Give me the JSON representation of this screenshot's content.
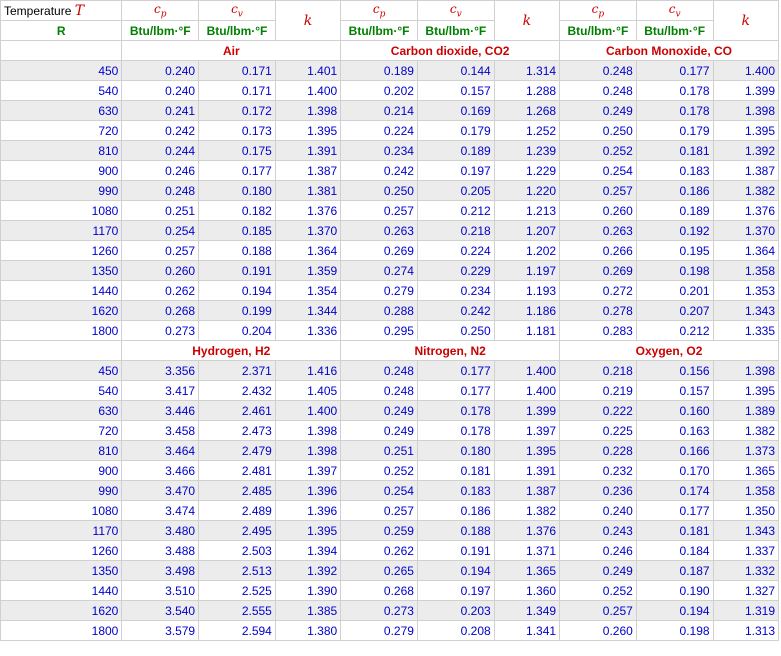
{
  "header": {
    "temperature_label": "Temperature",
    "temperature_symbol": "T",
    "temperature_unit": "R",
    "cp_symbol": "c",
    "cp_sub": "p",
    "cv_symbol": "c",
    "cv_sub": "v",
    "k_symbol": "k",
    "unit": "Btu/lbm·°F"
  },
  "colors": {
    "symbol": "#cc0000",
    "unit": "#008000",
    "value": "#0000cc",
    "stripe": "#ececec"
  },
  "temperatures": [
    "450",
    "540",
    "630",
    "720",
    "810",
    "900",
    "990",
    "1080",
    "1170",
    "1260",
    "1350",
    "1440",
    "1620",
    "1800"
  ],
  "groups": [
    {
      "gases": [
        "Air",
        "Carbon dioxide, CO2",
        "Carbon Monoxide, CO"
      ],
      "rows": [
        [
          "0.240",
          "0.171",
          "1.401",
          "0.189",
          "0.144",
          "1.314",
          "0.248",
          "0.177",
          "1.400"
        ],
        [
          "0.240",
          "0.171",
          "1.400",
          "0.202",
          "0.157",
          "1.288",
          "0.248",
          "0.178",
          "1.399"
        ],
        [
          "0.241",
          "0.172",
          "1.398",
          "0.214",
          "0.169",
          "1.268",
          "0.249",
          "0.178",
          "1.398"
        ],
        [
          "0.242",
          "0.173",
          "1.395",
          "0.224",
          "0.179",
          "1.252",
          "0.250",
          "0.179",
          "1.395"
        ],
        [
          "0.244",
          "0.175",
          "1.391",
          "0.234",
          "0.189",
          "1.239",
          "0.252",
          "0.181",
          "1.392"
        ],
        [
          "0.246",
          "0.177",
          "1.387",
          "0.242",
          "0.197",
          "1.229",
          "0.254",
          "0.183",
          "1.387"
        ],
        [
          "0.248",
          "0.180",
          "1.381",
          "0.250",
          "0.205",
          "1.220",
          "0.257",
          "0.186",
          "1.382"
        ],
        [
          "0.251",
          "0.182",
          "1.376",
          "0.257",
          "0.212",
          "1.213",
          "0.260",
          "0.189",
          "1.376"
        ],
        [
          "0.254",
          "0.185",
          "1.370",
          "0.263",
          "0.218",
          "1.207",
          "0.263",
          "0.192",
          "1.370"
        ],
        [
          "0.257",
          "0.188",
          "1.364",
          "0.269",
          "0.224",
          "1.202",
          "0.266",
          "0.195",
          "1.364"
        ],
        [
          "0.260",
          "0.191",
          "1.359",
          "0.274",
          "0.229",
          "1.197",
          "0.269",
          "0.198",
          "1.358"
        ],
        [
          "0.262",
          "0.194",
          "1.354",
          "0.279",
          "0.234",
          "1.193",
          "0.272",
          "0.201",
          "1.353"
        ],
        [
          "0.268",
          "0.199",
          "1.344",
          "0.288",
          "0.242",
          "1.186",
          "0.278",
          "0.207",
          "1.343"
        ],
        [
          "0.273",
          "0.204",
          "1.336",
          "0.295",
          "0.250",
          "1.181",
          "0.283",
          "0.212",
          "1.335"
        ]
      ]
    },
    {
      "gases": [
        "Hydrogen, H2",
        "Nitrogen, N2",
        "Oxygen, O2"
      ],
      "rows": [
        [
          "3.356",
          "2.371",
          "1.416",
          "0.248",
          "0.177",
          "1.400",
          "0.218",
          "0.156",
          "1.398"
        ],
        [
          "3.417",
          "2.432",
          "1.405",
          "0.248",
          "0.177",
          "1.400",
          "0.219",
          "0.157",
          "1.395"
        ],
        [
          "3.446",
          "2.461",
          "1.400",
          "0.249",
          "0.178",
          "1.399",
          "0.222",
          "0.160",
          "1.389"
        ],
        [
          "3.458",
          "2.473",
          "1.398",
          "0.249",
          "0.178",
          "1.397",
          "0.225",
          "0.163",
          "1.382"
        ],
        [
          "3.464",
          "2.479",
          "1.398",
          "0.251",
          "0.180",
          "1.395",
          "0.228",
          "0.166",
          "1.373"
        ],
        [
          "3.466",
          "2.481",
          "1.397",
          "0.252",
          "0.181",
          "1.391",
          "0.232",
          "0.170",
          "1.365"
        ],
        [
          "3.470",
          "2.485",
          "1.396",
          "0.254",
          "0.183",
          "1.387",
          "0.236",
          "0.174",
          "1.358"
        ],
        [
          "3.474",
          "2.489",
          "1.396",
          "0.257",
          "0.186",
          "1.382",
          "0.240",
          "0.177",
          "1.350"
        ],
        [
          "3.480",
          "2.495",
          "1.395",
          "0.259",
          "0.188",
          "1.376",
          "0.243",
          "0.181",
          "1.343"
        ],
        [
          "3.488",
          "2.503",
          "1.394",
          "0.262",
          "0.191",
          "1.371",
          "0.246",
          "0.184",
          "1.337"
        ],
        [
          "3.498",
          "2.513",
          "1.392",
          "0.265",
          "0.194",
          "1.365",
          "0.249",
          "0.187",
          "1.332"
        ],
        [
          "3.510",
          "2.525",
          "1.390",
          "0.268",
          "0.197",
          "1.360",
          "0.252",
          "0.190",
          "1.327"
        ],
        [
          "3.540",
          "2.555",
          "1.385",
          "0.273",
          "0.203",
          "1.349",
          "0.257",
          "0.194",
          "1.319"
        ],
        [
          "3.579",
          "2.594",
          "1.380",
          "0.279",
          "0.208",
          "1.341",
          "0.260",
          "0.198",
          "1.313"
        ]
      ]
    }
  ]
}
